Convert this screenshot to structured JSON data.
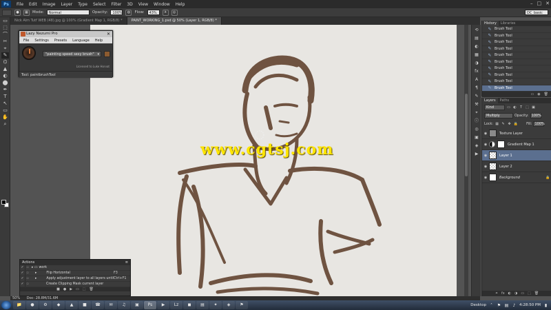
{
  "menubar": {
    "logo": "Ps",
    "items": [
      "File",
      "Edit",
      "Image",
      "Layer",
      "Type",
      "Select",
      "Filter",
      "3D",
      "View",
      "Window",
      "Help"
    ],
    "window_controls": [
      "–",
      "□",
      "✕"
    ]
  },
  "optbar": {
    "mode_label": "Mode:",
    "mode_value": "Normal",
    "opacity_label": "Opacity:",
    "opacity_value": "100%",
    "flow_label": "Flow:",
    "flow_value": "43%",
    "workspace": "DC_basic"
  },
  "tabs": [
    {
      "label": "Nick Alm Tutf WEB (48).jpg @ 100% (Gradient Map 1, RGB/8) *",
      "active": false
    },
    {
      "label": "PAINT_WORKING_1.psd @ 50% (Layer 1, RGB/8) *",
      "active": true
    }
  ],
  "tools": [
    "▭",
    "⬚",
    "⌒",
    "✂",
    "⌖",
    "✎",
    "⌬",
    "▲",
    "◐",
    "⬤",
    "✒",
    "T",
    "↖",
    "▭",
    "✋",
    "⌕"
  ],
  "lazy": {
    "title": "Lazy Nezumi Pro",
    "menu": [
      "File",
      "Settings",
      "Presets",
      "Language",
      "Help"
    ],
    "preset": "\"painting speed sexy brush\"",
    "licensed": "Licensed to Luke Horvat",
    "status": "Tool: paintbrushTool"
  },
  "watermark": "www.cgtsj.com",
  "actions": {
    "title": "Actions",
    "rows": [
      {
        "check": "✓",
        "name": "work",
        "key": "",
        "level": 0
      },
      {
        "check": "✓",
        "name": "Flip Horizontal",
        "key": "F3",
        "level": 1
      },
      {
        "check": "✓",
        "name": "Apply adjustment layer to all layers until group",
        "key": "Ctrl+F1",
        "level": 1
      },
      {
        "check": "✓",
        "name": "Create Clipping Mask current layer",
        "key": "",
        "level": 2
      }
    ],
    "footer": [
      "■",
      "●",
      "▶",
      "▭",
      "⬚",
      "🗑"
    ]
  },
  "status": {
    "zoom": "50%",
    "doc": "Doc: 28.8M/31.6M"
  },
  "history": {
    "tabs": [
      "History",
      "Libraries"
    ],
    "items": [
      {
        "label": "Brush Tool"
      },
      {
        "label": "Brush Tool"
      },
      {
        "label": "Brush Tool"
      },
      {
        "label": "Brush Tool"
      },
      {
        "label": "Brush Tool"
      },
      {
        "label": "Brush Tool"
      },
      {
        "label": "Brush Tool"
      },
      {
        "label": "Brush Tool"
      },
      {
        "label": "Brush Tool"
      },
      {
        "label": "Brush Tool",
        "active": true
      }
    ]
  },
  "layers": {
    "tabs": [
      "Layers",
      "Paths"
    ],
    "kind": "Kind",
    "blend": "Multiply",
    "opacity_label": "Opacity:",
    "opacity_value": "100%",
    "lock_label": "Lock:",
    "fill_label": "Fill:",
    "fill_value": "100%",
    "items": [
      {
        "name": "Texture Layer",
        "thumb": "gray",
        "selected": false
      },
      {
        "name": "Gradient Map 1",
        "thumb": "adj",
        "selected": false
      },
      {
        "name": "Layer 1",
        "thumb": "checker",
        "selected": true
      },
      {
        "name": "Layer 2",
        "thumb": "checker",
        "selected": false
      },
      {
        "name": "Background",
        "thumb": "white",
        "selected": false,
        "italic": true
      }
    ],
    "footer": [
      "⚭",
      "fx",
      "◐",
      "◑",
      "▭",
      "⬚",
      "🗑"
    ]
  },
  "taskbar": {
    "apps": [
      "📁",
      "●",
      "⚙",
      "◆",
      "▲",
      "■",
      "☎",
      "✉",
      "♫",
      "▣",
      "Ps",
      "▶",
      "Lz",
      "◼",
      "▤",
      "✦",
      "◈",
      "⚑"
    ],
    "active_index": 10,
    "desktop_label": "Desktop",
    "time": "4:28:50 PM"
  },
  "colors": {
    "sketch": "#5a3a25",
    "accent": "#5b6f8f",
    "watermark": "#ffe600"
  }
}
